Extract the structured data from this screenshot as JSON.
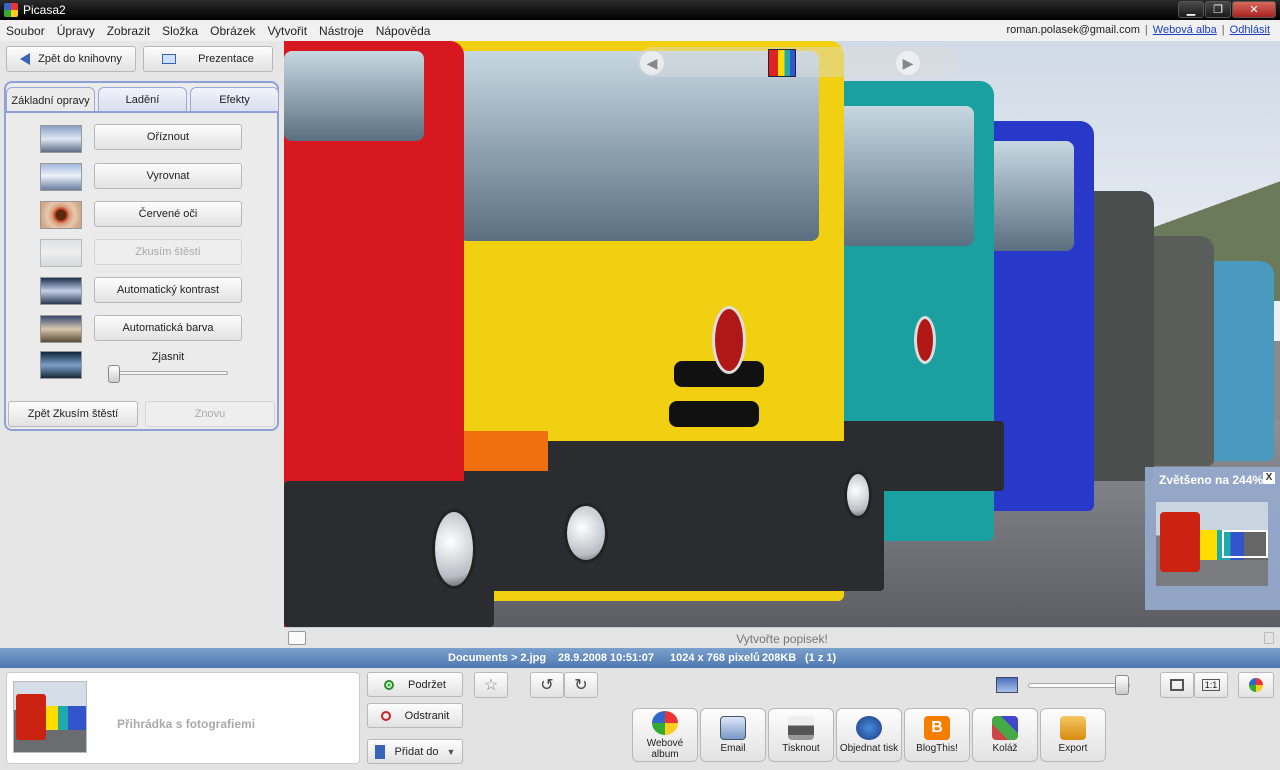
{
  "window": {
    "title": "Picasa2"
  },
  "menu": [
    "Soubor",
    "Úpravy",
    "Zobrazit",
    "Složka",
    "Obrázek",
    "Vytvořit",
    "Nástroje",
    "Nápověda"
  ],
  "account": {
    "email": "roman.polasek@gmail.com",
    "web_albums": "Webová alba",
    "logout": "Odhlásit",
    "separator": "|"
  },
  "left_panel": {
    "back_button": "Zpět do knihovny",
    "slideshow_button": "Prezentace",
    "tabs": [
      "Základní opravy",
      "Ladění",
      "Efekty"
    ],
    "fixes": [
      {
        "label": "Oříznout",
        "enabled": true
      },
      {
        "label": "Vyrovnat",
        "enabled": true
      },
      {
        "label": "Červené oči",
        "enabled": true
      },
      {
        "label": "Zkusím štěstí",
        "enabled": false
      },
      {
        "label": "Automatický kontrast",
        "enabled": true
      },
      {
        "label": "Automatická barva",
        "enabled": true
      }
    ],
    "sharpen_label": "Zjasnit",
    "sharpen_value": 0,
    "undo_button": "Zpět Zkusím štěstí",
    "redo_button": "Znovu"
  },
  "viewer": {
    "caption_placeholder": "Vytvořte popisek!",
    "zoom_label": "Zvětšeno na 244%",
    "zoom_close": "X"
  },
  "info": {
    "path": "Documents > 2.jpg",
    "datetime": "28.9.2008 10:51:07",
    "dimensions": "1024 x 768 pixelů",
    "size": "208KB",
    "position": "(1 z 1)"
  },
  "tray": {
    "label": "Přihrádka s fotografiemi",
    "hold_button": "Podržet",
    "remove_button": "Odstranit",
    "add_button": "Přidat do"
  },
  "toolbar": {
    "star_icon": "☆",
    "rotate_left_icon": "↺",
    "rotate_right_icon": "↻",
    "fit_label": "",
    "actual_label": "1:1",
    "size_value": 0.87
  },
  "actions": [
    {
      "label": "Webové album",
      "icon": "globe"
    },
    {
      "label": "Email",
      "icon": "mail"
    },
    {
      "label": "Tisknout",
      "icon": "printer"
    },
    {
      "label": "Objednat tisk",
      "icon": "order"
    },
    {
      "label": "BlogThis!",
      "icon": "blog"
    },
    {
      "label": "Koláž",
      "icon": "collage"
    },
    {
      "label": "Export",
      "icon": "export"
    }
  ]
}
